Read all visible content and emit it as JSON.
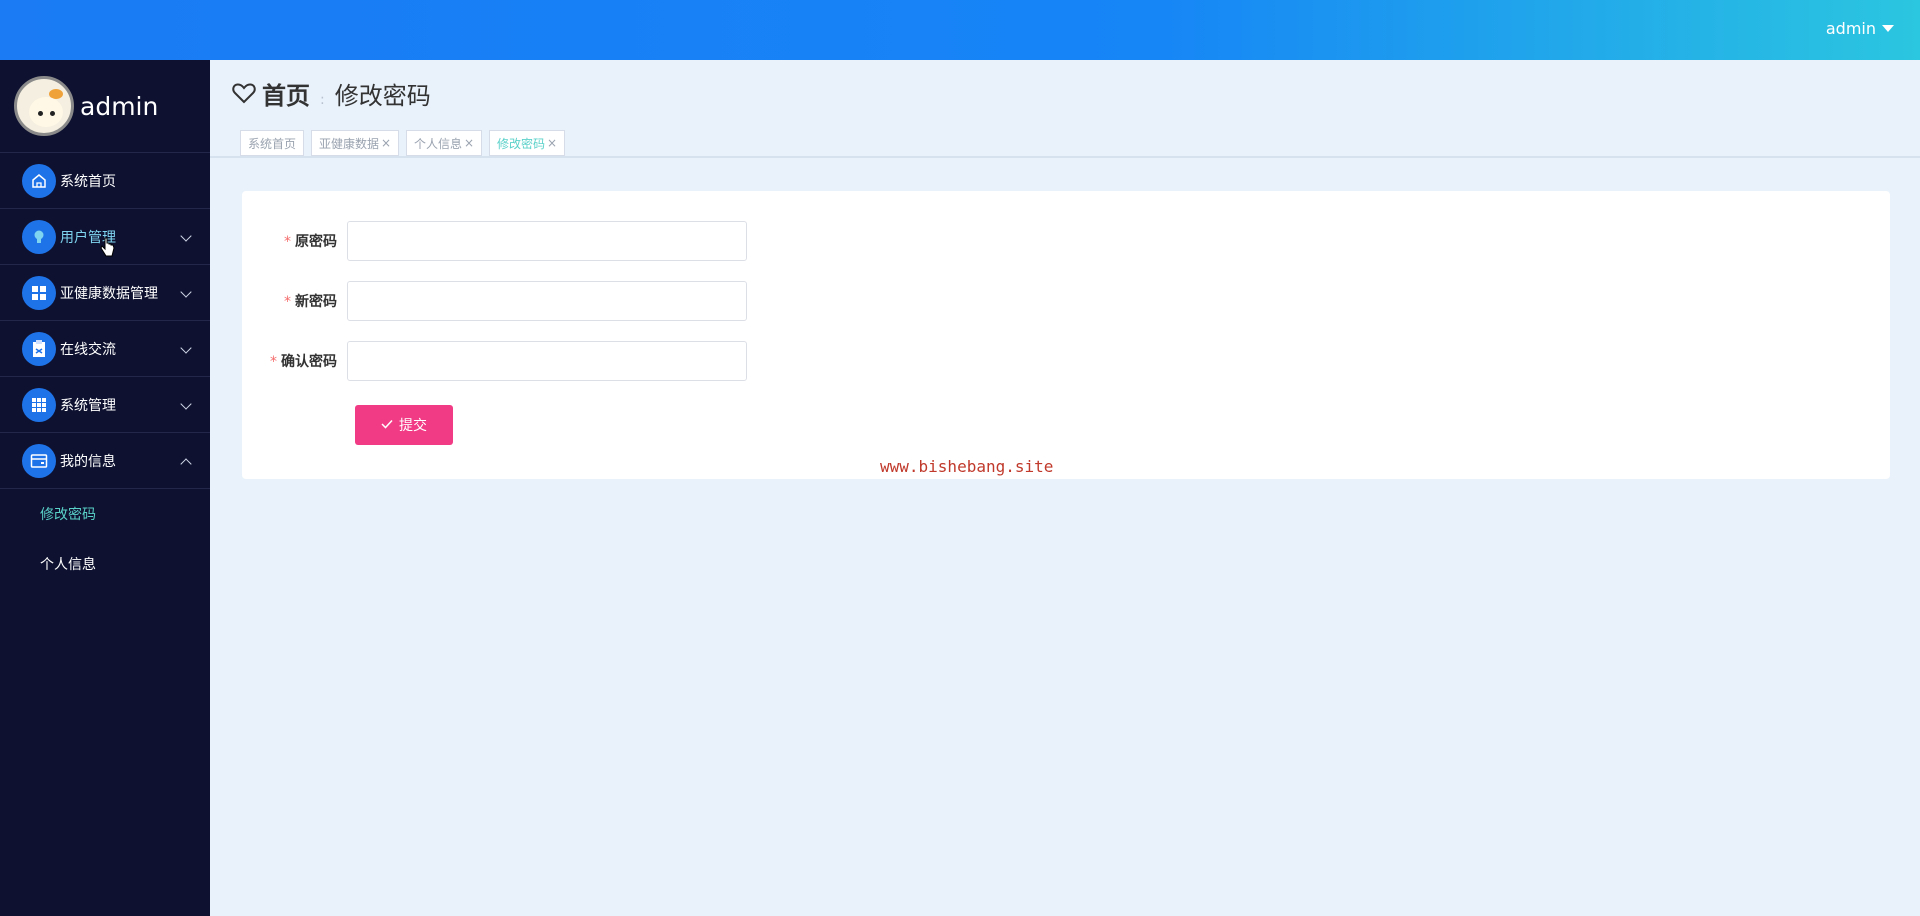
{
  "header": {
    "user_label": "admin"
  },
  "sidebar": {
    "profile_name": "admin",
    "items": [
      {
        "label": "系统首页",
        "icon": "home-icon",
        "has_children": false
      },
      {
        "label": "用户管理",
        "icon": "lightbulb-icon",
        "has_children": true,
        "state": "collapsed",
        "hover": true
      },
      {
        "label": "亚健康数据管理",
        "icon": "grid-icon",
        "has_children": true,
        "state": "collapsed"
      },
      {
        "label": "在线交流",
        "icon": "clipboard-icon",
        "has_children": true,
        "state": "collapsed"
      },
      {
        "label": "系统管理",
        "icon": "table-icon",
        "has_children": true,
        "state": "collapsed"
      },
      {
        "label": "我的信息",
        "icon": "card-icon",
        "has_children": true,
        "state": "expanded"
      }
    ],
    "sub_items": [
      {
        "label": "修改密码",
        "active": true
      },
      {
        "label": "个人信息",
        "active": false
      }
    ]
  },
  "breadcrumb": {
    "home": "首页",
    "separator": ":",
    "current": "修改密码"
  },
  "tags": [
    {
      "label": "系统首页",
      "closable": false
    },
    {
      "label": "亚健康数据",
      "closable": true
    },
    {
      "label": "个人信息",
      "closable": true
    },
    {
      "label": "修改密码",
      "closable": true,
      "active": true
    }
  ],
  "form": {
    "required_mark": "*",
    "old_password_label": "原密码",
    "new_password_label": "新密码",
    "confirm_password_label": "确认密码",
    "old_password_value": "",
    "new_password_value": "",
    "confirm_password_value": "",
    "submit_label": "提交"
  },
  "watermark": "www.bishebang.site",
  "colors": {
    "topbar_start": "#1a7bf5",
    "topbar_end": "#2bc6e0",
    "sidebar_bg": "#0e1230",
    "accent_icon": "#1f73e8",
    "submit_bg": "#f23b85",
    "active_text": "#5ad1c9"
  }
}
